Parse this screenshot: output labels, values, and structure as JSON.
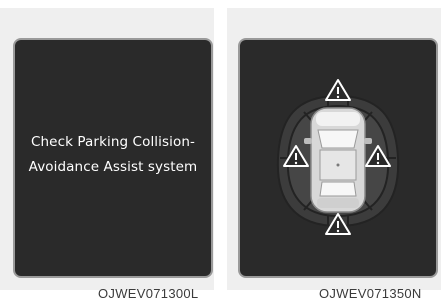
{
  "panels": [
    {
      "screen": {
        "message_line1": "Check Parking Collision-",
        "message_line2": "Avoidance Assist system"
      },
      "image_code": "OJWEV071300L"
    },
    {
      "screen": {
        "icons": [
          "warning-triangle-icon",
          "car-top-view-icon",
          "sensor-zones"
        ]
      },
      "image_code": "OJWEV071350N"
    }
  ],
  "colors": {
    "screen_background": "#2a2a2a",
    "panel_background": "#efefef",
    "zone_fill": "#4a4a4a",
    "warning_fill": "#ffffff"
  }
}
